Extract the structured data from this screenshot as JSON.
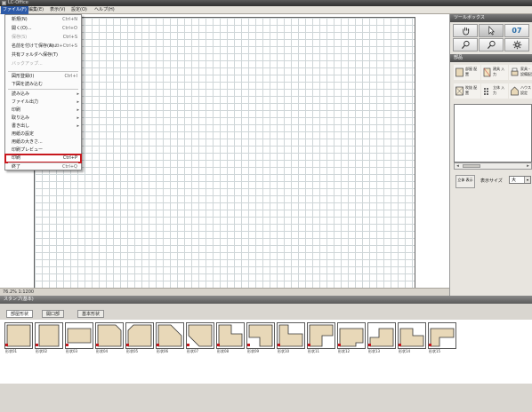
{
  "app": {
    "title": "LC-Office"
  },
  "menubar": [
    {
      "label": "ファイル(F)",
      "active": true
    },
    {
      "label": "編集(E)"
    },
    {
      "label": "表示(V)"
    },
    {
      "label": "設定(O)"
    },
    {
      "label": "ヘルプ(H)"
    }
  ],
  "file_menu": [
    {
      "label": "新規(N)",
      "shortcut": "Ctrl+N"
    },
    {
      "label": "開く(O)...",
      "shortcut": "Ctrl+O"
    },
    {
      "label": "保存(S)",
      "shortcut": "Ctrl+S",
      "disabled": true
    },
    {
      "label": "名前を付けて保存(A)...",
      "shortcut": "Shift+Ctrl+S"
    },
    {
      "label": "共有フォルダへ保存(T)"
    },
    {
      "label": "バックアップ...",
      "disabled": true
    },
    {
      "label": "図形登録(I)",
      "shortcut": "Ctrl+I"
    },
    {
      "label": "下図を読み込む"
    },
    {
      "label": "読み込み",
      "submenu": true
    },
    {
      "label": "ファイル出力",
      "submenu": true
    },
    {
      "label": "印刷",
      "submenu": true
    },
    {
      "label": "取り込み",
      "submenu": true
    },
    {
      "label": "書き出し",
      "submenu": true
    },
    {
      "label": "用紙の設定"
    },
    {
      "label": "用紙の大きさ..."
    },
    {
      "label": "印刷プレビュー"
    },
    {
      "label": "印刷",
      "shortcut": "Ctrl+P",
      "selected": true
    },
    {
      "label": "終了",
      "shortcut": "Ctrl+Q"
    }
  ],
  "status": {
    "scale_text": "76.2% 1:1200"
  },
  "right_panel": {
    "tools_header": "ツールボックス",
    "tools": [
      {
        "icon": "hand-icon"
      },
      {
        "icon": "arrow-cursor-icon"
      },
      {
        "icon": "wall-tool-icon",
        "label": "07"
      },
      {
        "icon": "zoom-in-icon"
      },
      {
        "icon": "zoom-out-icon"
      },
      {
        "icon": "settings-gear-icon"
      }
    ],
    "parts_header": "部品",
    "parts": [
      {
        "label": "部屋 配置"
      },
      {
        "label": "建具 入力"
      },
      {
        "label": "家具・ 設備配置"
      },
      {
        "label": "吹抜 配置"
      },
      {
        "label": "立体 入力"
      },
      {
        "label": "ハウス 設定"
      }
    ],
    "small_button": "立体 表示",
    "view_label": "表示サイズ",
    "view_select": "大"
  },
  "stamp_panel": {
    "header": "スタンプ(基本)",
    "tabs": [
      "部屋形状",
      "開口部",
      "基本形状"
    ],
    "stamps": [
      "形状01",
      "形状02",
      "形状03",
      "形状04",
      "形状05",
      "形状06",
      "形状07",
      "形状08",
      "形状09",
      "形状10",
      "形状11",
      "形状12",
      "形状13",
      "形状14",
      "形状15"
    ],
    "stamp_fill": "#e8d8b8",
    "accent_red": "#c8181e"
  }
}
